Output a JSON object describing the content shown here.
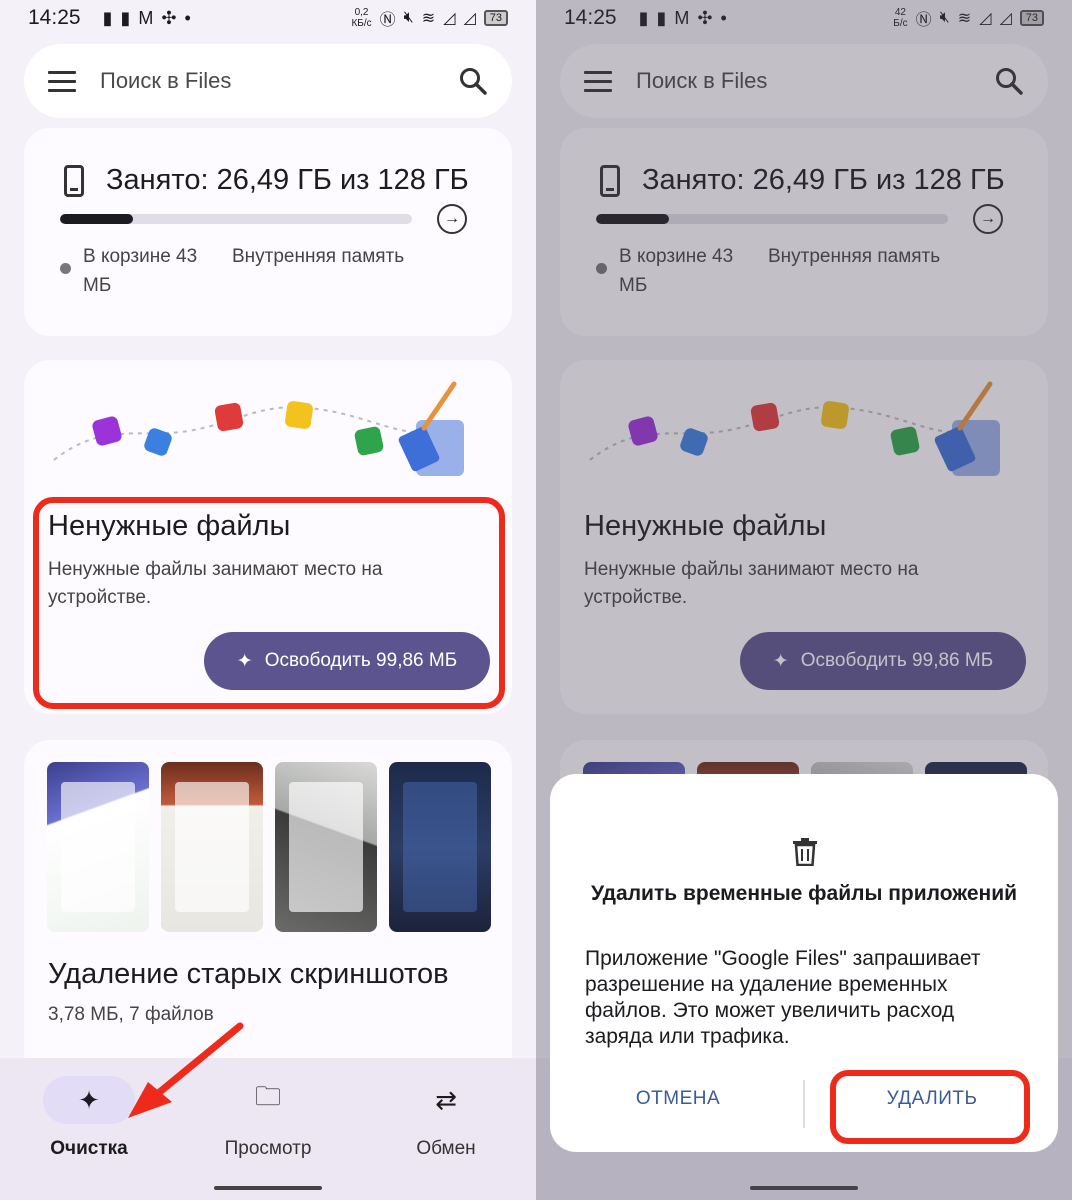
{
  "status_bar": {
    "time": "14:25",
    "left_speed_value": "0,2",
    "left_speed_unit": "КБ/с",
    "right_speed_value": "42",
    "right_speed_unit": "Б/с",
    "battery": "73"
  },
  "search": {
    "placeholder": "Поиск в Files"
  },
  "storage": {
    "title": "Занято: 26,49 ГБ из 128 ГБ",
    "used_fraction": 0.207,
    "trash_label": "В корзине 43 МБ",
    "location_label": "Внутренняя память"
  },
  "junk": {
    "title": "Ненужные файлы",
    "description": "Ненужные файлы занимают место на устройстве.",
    "button_label": "Освободить 99,86 МБ"
  },
  "screenshots": {
    "title": "Удаление старых скриншотов",
    "subtitle": "3,78 МБ, 7 файлов"
  },
  "bottom_nav": {
    "items": [
      {
        "label": "Очистка",
        "icon": "sparkle-icon",
        "active": true
      },
      {
        "label": "Просмотр",
        "icon": "folder-search-icon",
        "active": false
      },
      {
        "label": "Обмен",
        "icon": "share-swap-icon",
        "active": false
      }
    ]
  },
  "dialog": {
    "title": "Удалить временные файлы приложений",
    "body": "Приложение \"Google Files\" запрашивает разрешение на удаление временных файлов. Это может увеличить расход заряда или трафика.",
    "cancel_label": "ОТМЕНА",
    "delete_label": "УДАЛИТЬ"
  },
  "colors": {
    "primary_button": "#5c548e",
    "annotation_red": "#ee2a1b",
    "dialog_action": "#3b5a99"
  }
}
